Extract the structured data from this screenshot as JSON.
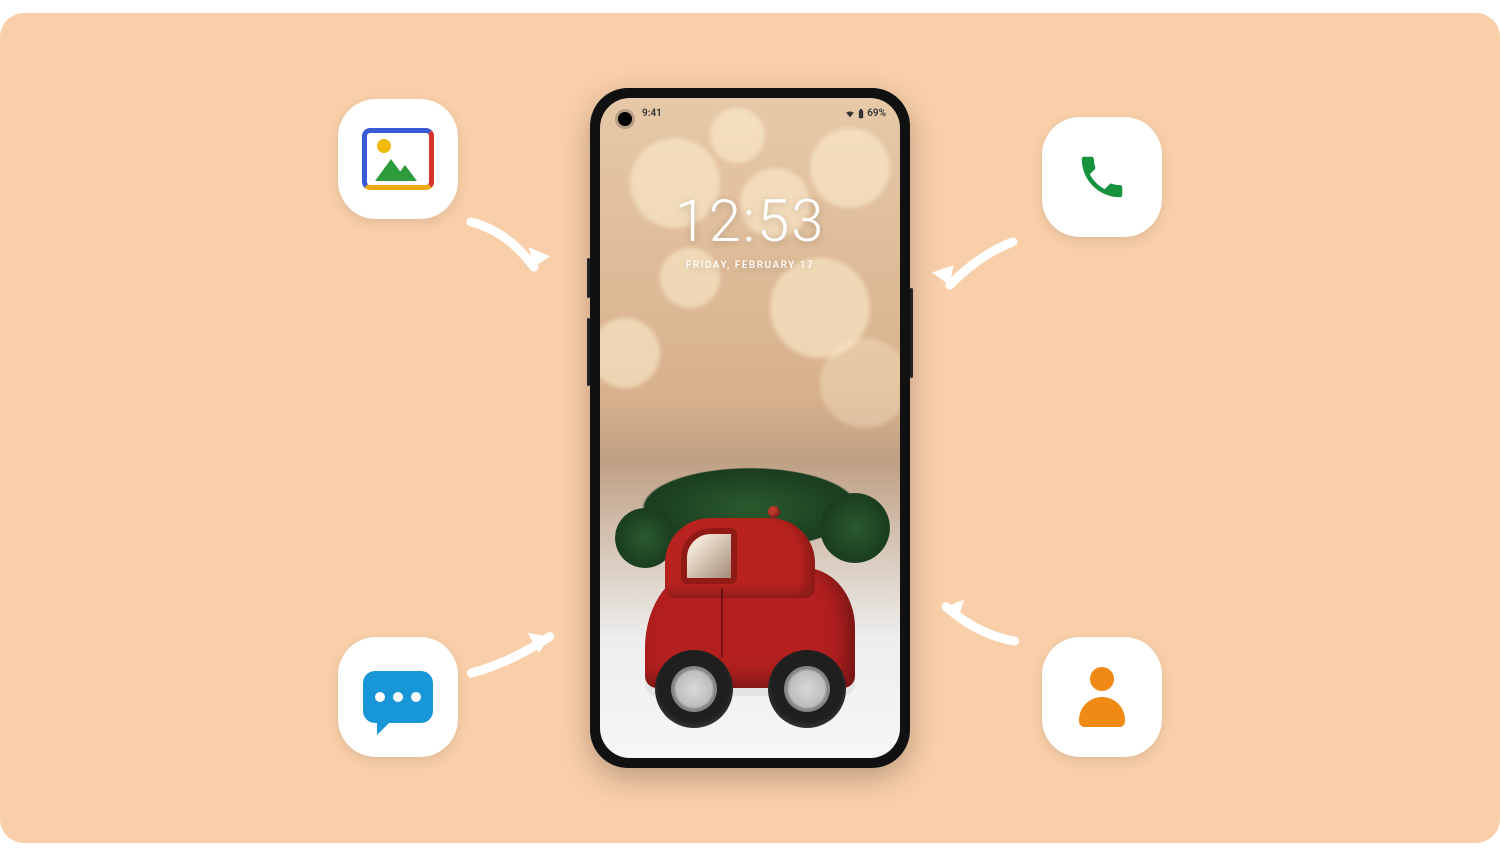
{
  "phone": {
    "status_bar": {
      "time_small": "9:41",
      "battery": "69%"
    },
    "lock_screen": {
      "time": "12:53",
      "date": "FRIDAY, FEBRUARY 17"
    }
  },
  "icons": {
    "gallery": "gallery-icon",
    "call": "phone-call-icon",
    "messages": "messages-icon",
    "contacts": "contacts-icon"
  }
}
